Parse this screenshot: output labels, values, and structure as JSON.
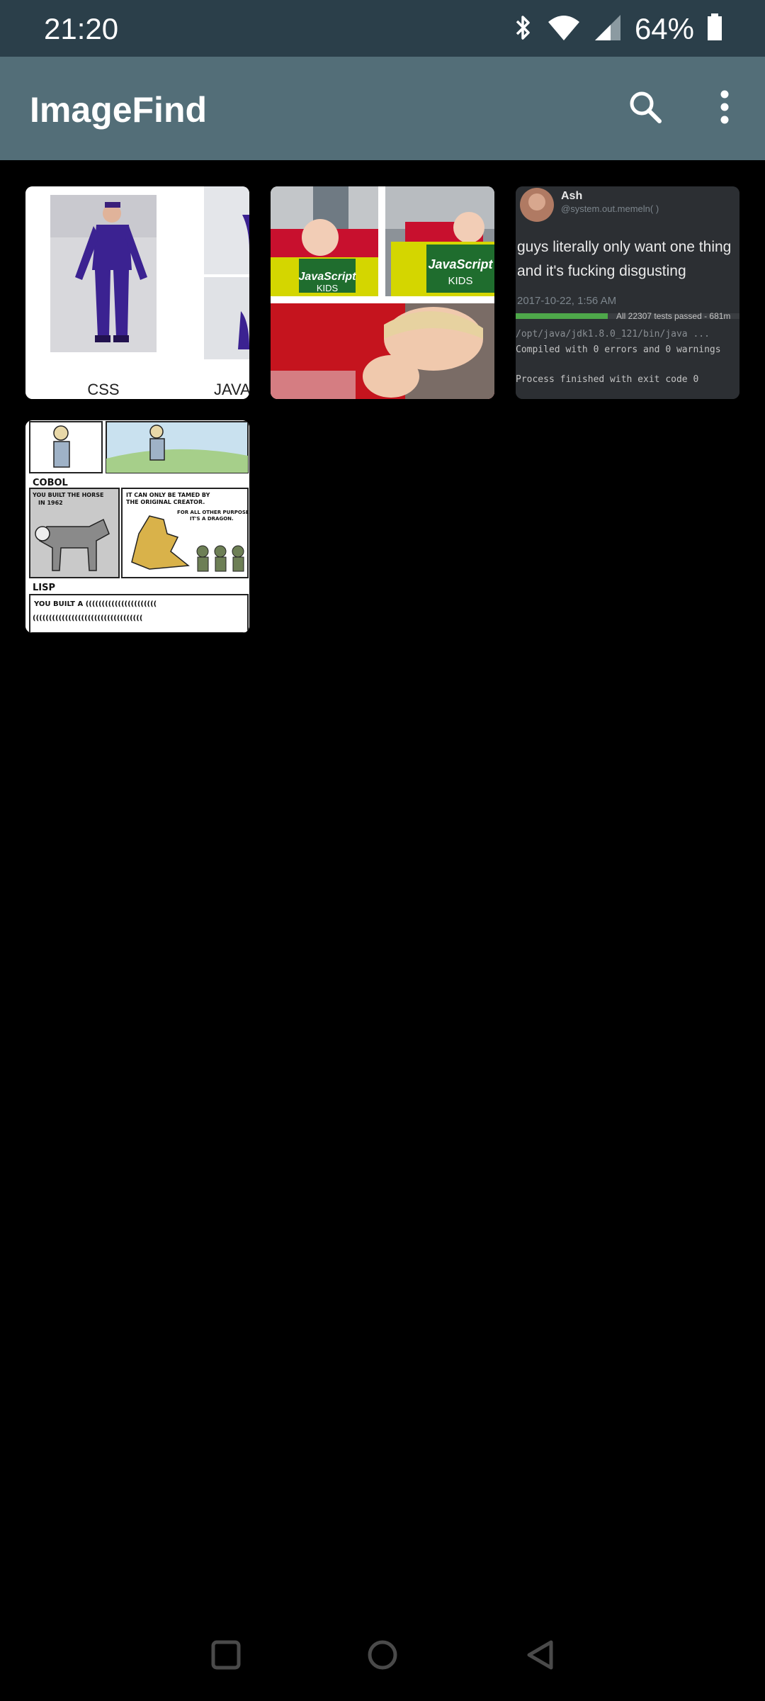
{
  "status_bar": {
    "time": "21:20",
    "battery": "64%",
    "icons": [
      "bluetooth-icon",
      "wifi-icon",
      "cell-signal-icon",
      "battery-icon"
    ]
  },
  "app_bar": {
    "title": "ImageFind",
    "actions": [
      "search-icon",
      "more-vert-icon"
    ]
  },
  "images": [
    {
      "name": "css-java-meme",
      "labels": [
        "CSS",
        "JAVA"
      ]
    },
    {
      "name": "javascript-kids-meme",
      "book_title": "JavaScript",
      "book_subtitle": "KIDS"
    },
    {
      "name": "tweet-screenshot-meme",
      "author": "Ash",
      "handle": "@system.out.memeln( )",
      "text_line1": "guys literally only want one thing",
      "text_line2": "and it's fucking disgusting",
      "date": "2017-10-22, 1:56 AM",
      "tests": "All 22307 tests passed - 681m",
      "path": "/opt/java/jdk1.8.0_121/bin/java ...",
      "compiled": "Compiled with 0 errors and 0 warnings",
      "exit": "Process finished with exit code 0"
    },
    {
      "name": "cobol-lisp-comic",
      "heading_cobol": "COBOL",
      "cobol_caption": "YOU BUILT THE HORSE",
      "cobol_caption2": "IN 1962",
      "dragon_caption": "IT CAN ONLY BE TAMED BY",
      "dragon_caption2": "THE ORIGINAL CREATOR.",
      "purposes_caption": "FOR ALL OTHER PURPOSES",
      "purposes_caption2": "IT'S A DRAGON.",
      "heading_lisp": "LISP",
      "lisp_caption": "YOU BUILT A ((((((((((((((((((((((",
      "lisp_caption2": "(((((((((((((((((((((((((((((((((("
    }
  ],
  "nav_bar": {
    "buttons": [
      "recents-square-icon",
      "home-circle-icon",
      "back-triangle-icon"
    ]
  },
  "colors": {
    "status_bar": "#2b3f4a",
    "app_bar": "#536e78",
    "background": "#000000"
  }
}
